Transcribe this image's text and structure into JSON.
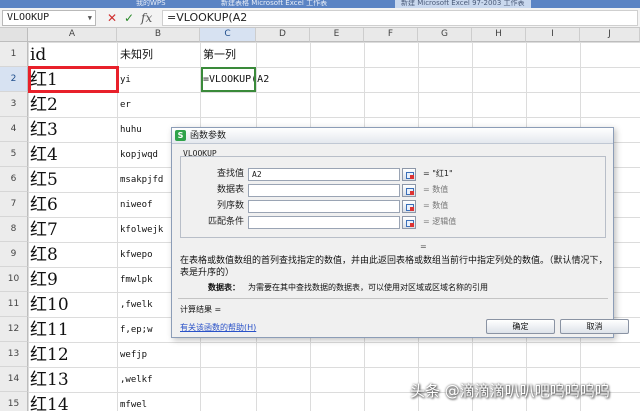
{
  "window": {
    "tabs": [
      {
        "label": "我的WPS",
        "active": false
      },
      {
        "label": "新建表格 Microsoft Excel 工作表",
        "active": false
      },
      {
        "label": "新建 Microsoft Excel 97-2003 工作表",
        "active": true
      }
    ]
  },
  "formula_bar": {
    "name_box": "VLOOKUP",
    "cancel_icon": "✕",
    "confirm_icon": "✓",
    "fx_label": "fx",
    "formula": "=VLOOKUP(A2"
  },
  "columns": [
    "A",
    "B",
    "C",
    "D",
    "E",
    "F",
    "G",
    "H",
    "I",
    "J"
  ],
  "rows": [
    {
      "num": "1",
      "a": "id",
      "b": "未知列",
      "c": "第一列"
    },
    {
      "num": "2",
      "a": "红1",
      "b": "yi",
      "c": "=VLOOKUP(A2"
    },
    {
      "num": "3",
      "a": "红2",
      "b": "er",
      "c": ""
    },
    {
      "num": "4",
      "a": "红3",
      "b": "huhu",
      "c": ""
    },
    {
      "num": "5",
      "a": "红4",
      "b": "kopjwqd",
      "c": ""
    },
    {
      "num": "6",
      "a": "红5",
      "b": "msakpjfd",
      "c": ""
    },
    {
      "num": "7",
      "a": "红6",
      "b": "niweof",
      "c": ""
    },
    {
      "num": "8",
      "a": "红7",
      "b": "kfolwejk",
      "c": ""
    },
    {
      "num": "9",
      "a": "红8",
      "b": "kfwepo",
      "c": ""
    },
    {
      "num": "10",
      "a": "红9",
      "b": "fmwlpk",
      "c": ""
    },
    {
      "num": "11",
      "a": "红10",
      "b": ",fwelk",
      "c": ""
    },
    {
      "num": "12",
      "a": "红11",
      "b": "f,ep;w",
      "c": ""
    },
    {
      "num": "13",
      "a": "红12",
      "b": "wefjp",
      "c": ""
    },
    {
      "num": "14",
      "a": "红13",
      "b": ",welkf",
      "c": ""
    },
    {
      "num": "15",
      "a": "红14",
      "b": "mfwel",
      "c": ""
    }
  ],
  "dialog": {
    "logo": "S",
    "title": "函数参数",
    "function_name": "VLOOKUP",
    "args": [
      {
        "label": "查找值",
        "value": "A2",
        "result": "= \"红1\""
      },
      {
        "label": "数据表",
        "value": "",
        "result": "= 数值"
      },
      {
        "label": "列序数",
        "value": "",
        "result": "= 数值"
      },
      {
        "label": "匹配条件",
        "value": "",
        "result": "= 逻辑值"
      }
    ],
    "equals": "=",
    "description": "在表格或数值数组的首列查找指定的数值，并由此返回表格或数组当前行中指定列处的数值。（默认情况下，表是升序的）",
    "arg_help_name": "数据表：",
    "arg_help_text": "为需要在其中查找数据的数据表，可以使用对区域或区域名称的引用",
    "calc_result": "计算结果 =",
    "help_link": "有关该函数的帮助(H)",
    "ok_label": "确定",
    "cancel_label": "取消"
  },
  "watermark": "头条 @滴滴滴叭叭吧呜呜呜呜",
  "colors": {
    "selection_border": "#e8202a",
    "active_cell_border": "#3a8a3a",
    "link": "#2a52c8"
  }
}
